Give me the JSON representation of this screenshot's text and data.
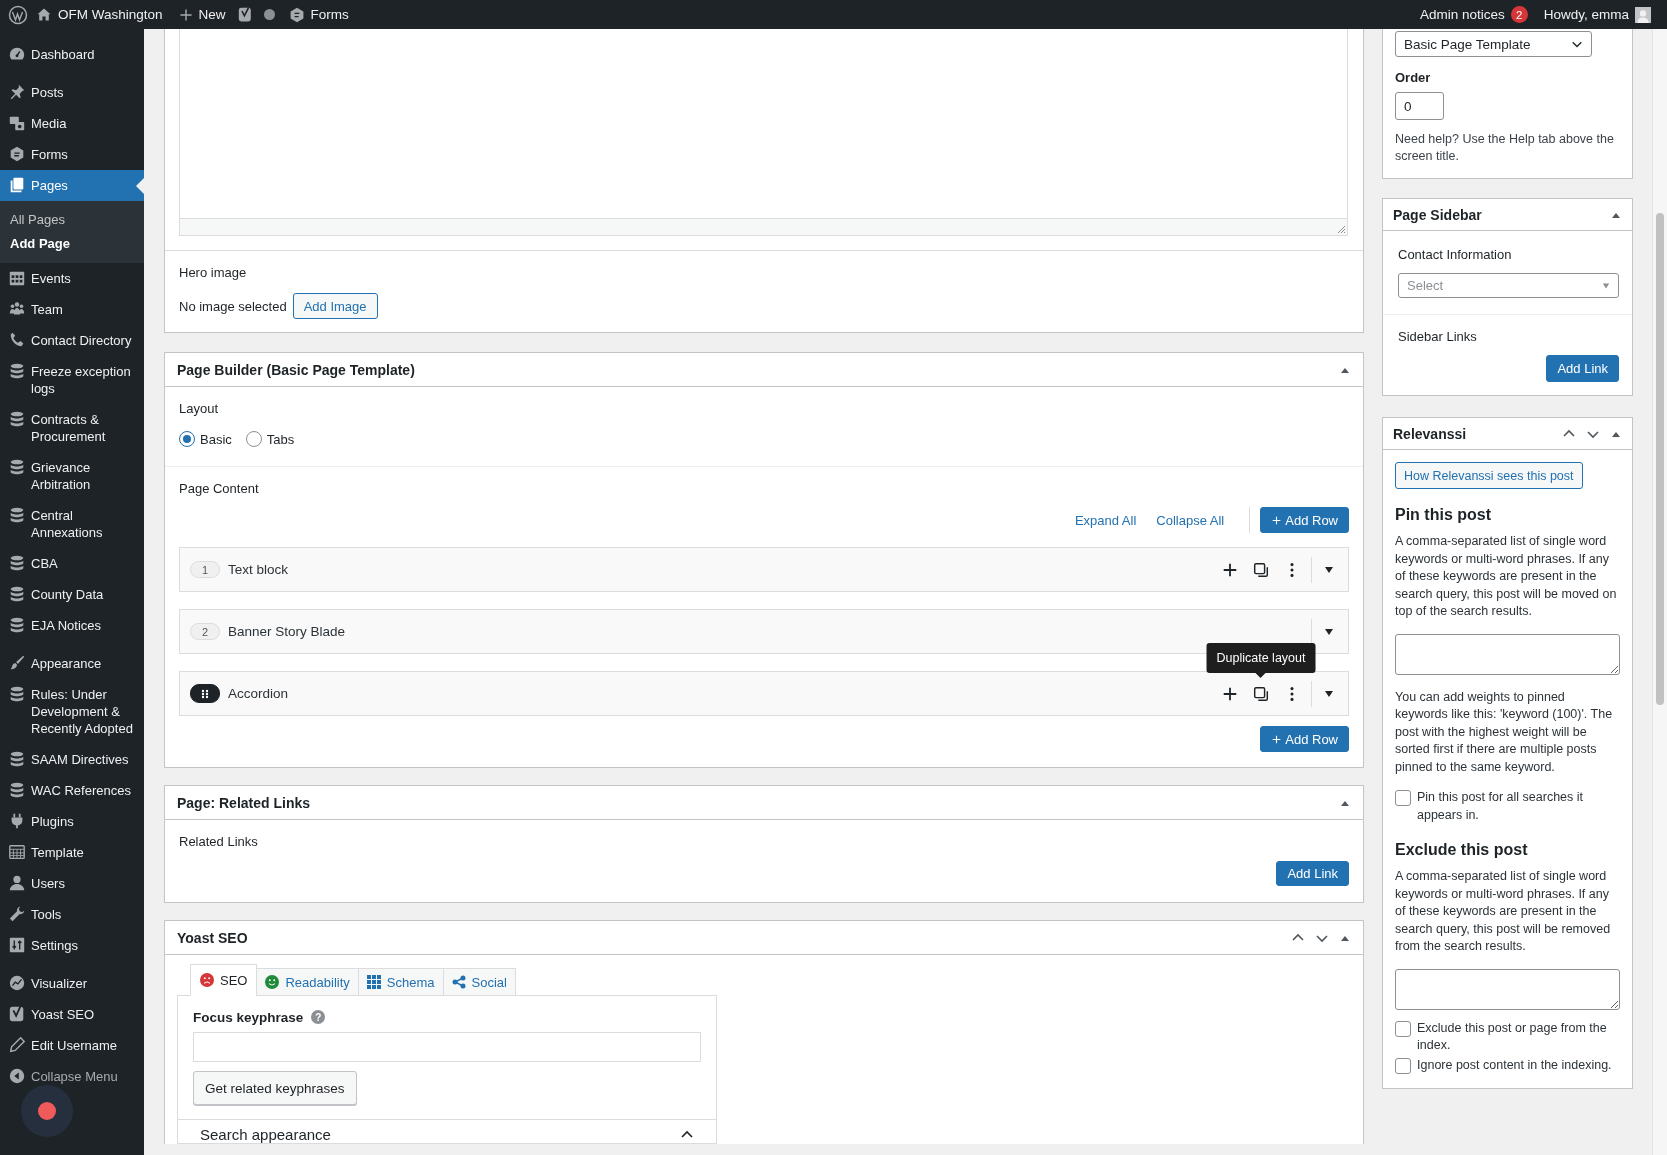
{
  "admin_bar": {
    "site_name": "OFM Washington",
    "new_label": "New",
    "forms_label": "Forms",
    "notices_label": "Admin notices",
    "notices_count": "2",
    "greeting": "Howdy, emma"
  },
  "admin_menu": {
    "groups": [
      {
        "items": [
          {
            "label": "Dashboard",
            "selected": false
          }
        ]
      },
      {
        "items": [
          {
            "label": "Posts",
            "selected": false
          },
          {
            "label": "Media",
            "selected": false
          },
          {
            "label": "Forms",
            "selected": false
          },
          {
            "label": "Pages",
            "selected": true,
            "children": [
              {
                "label": "All Pages",
                "selected": false
              },
              {
                "label": "Add Page",
                "selected": true
              }
            ]
          },
          {
            "label": "Events",
            "selected": false
          },
          {
            "label": "Team",
            "selected": false
          },
          {
            "label": "Contact Directory",
            "selected": false
          },
          {
            "label": "Freeze exception logs",
            "selected": false
          },
          {
            "label": "Contracts & Procurement",
            "selected": false
          },
          {
            "label": "Grievance Arbitration",
            "selected": false
          },
          {
            "label": "Central Annexations",
            "selected": false
          },
          {
            "label": "CBA",
            "selected": false
          },
          {
            "label": "County Data",
            "selected": false
          },
          {
            "label": "EJA Notices",
            "selected": false
          }
        ]
      },
      {
        "items": [
          {
            "label": "Appearance",
            "selected": false
          },
          {
            "label": "Rules: Under Development & Recently Adopted",
            "selected": false
          },
          {
            "label": "SAAM Directives",
            "selected": false
          },
          {
            "label": "WAC References",
            "selected": false
          },
          {
            "label": "Plugins",
            "selected": false
          },
          {
            "label": "Template",
            "selected": false
          },
          {
            "label": "Users",
            "selected": false
          },
          {
            "label": "Tools",
            "selected": false
          },
          {
            "label": "Settings",
            "selected": false
          }
        ]
      },
      {
        "items": [
          {
            "label": "Visualizer",
            "selected": false
          },
          {
            "label": "Yoast SEO",
            "selected": false
          },
          {
            "label": "Edit Username",
            "selected": false
          }
        ]
      }
    ],
    "collapse_label": "Collapse Menu"
  },
  "hero_image": {
    "label": "Hero image",
    "status": "No image selected",
    "button": "Add Image"
  },
  "page_builder": {
    "title": "Page Builder (Basic Page Template)",
    "layout_label": "Layout",
    "layout_options": [
      {
        "label": "Basic",
        "selected": true
      },
      {
        "label": "Tabs",
        "selected": false
      }
    ],
    "content_label": "Page Content",
    "expand_all": "Expand All",
    "collapse_all": "Collapse All",
    "add_row": "Add Row",
    "rows": [
      {
        "kind": "numbered",
        "handle": "1",
        "title": "Text block",
        "actions": true
      },
      {
        "kind": "numbered",
        "handle": "2",
        "title": "Banner Story Blade",
        "actions": false
      },
      {
        "kind": "drag",
        "title": "Accordion",
        "actions": true,
        "tooltip": "Duplicate layout"
      }
    ],
    "add_row_bottom": "Add Row"
  },
  "related_links": {
    "title": "Page: Related Links",
    "label": "Related Links",
    "button": "Add Link"
  },
  "yoast": {
    "title": "Yoast SEO",
    "tabs": [
      {
        "label": "SEO",
        "selected": true
      },
      {
        "label": "Readability",
        "selected": false
      },
      {
        "label": "Schema",
        "selected": false
      },
      {
        "label": "Social",
        "selected": false
      }
    ],
    "focus_label": "Focus keyphrase",
    "help_mark": "?",
    "related_button": "Get related keyphrases",
    "search_appearance": "Search appearance"
  },
  "page_attributes": {
    "template": "Basic Page Template",
    "order_label": "Order",
    "order_value": "0",
    "help": "Need help? Use the Help tab above the screen title."
  },
  "page_sidebar": {
    "title": "Page Sidebar",
    "contact_label": "Contact Information",
    "contact_placeholder": "Select",
    "links_label": "Sidebar Links",
    "button": "Add Link"
  },
  "relevanssi": {
    "title": "Relevanssi",
    "button": "How Relevanssi sees this post",
    "pin_heading": "Pin this post",
    "pin_help": "A comma-separated list of single word keywords or multi-word phrases. If any of these keywords are present in the search query, this post will be moved on top of the search results.",
    "weights_help": "You can add weights to pinned keywords like this: 'keyword (100)'. The post with the highest weight will be sorted first if there are multiple posts pinned to the same keyword.",
    "pin_all": {
      "label": "Pin this post for all searches it appears in.",
      "checked": false
    },
    "exclude_heading": "Exclude this post",
    "exclude_help": "A comma-separated list of single word keywords or multi-word phrases. If any of these keywords are present in the search query, this post will be removed from the search results.",
    "options": [
      {
        "label": "Exclude this post or page from the index.",
        "checked": false
      },
      {
        "label": "Ignore post content in the indexing.",
        "checked": false
      }
    ]
  }
}
